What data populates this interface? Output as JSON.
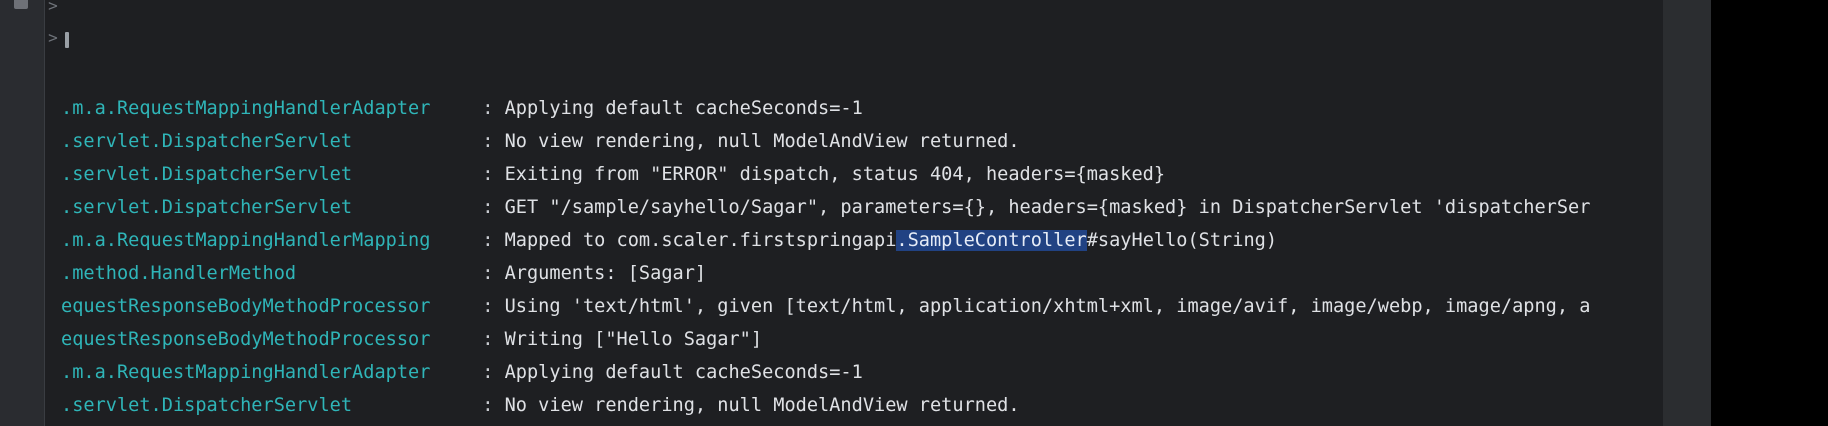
{
  "console": {
    "prompts": [
      ">",
      ">"
    ],
    "rows": [
      {
        "logger": ".m.a.RequestMappingHandlerAdapter",
        "message": "Applying default cacheSeconds=-1"
      },
      {
        "logger": ".servlet.DispatcherServlet",
        "message": "No view rendering, null ModelAndView returned."
      },
      {
        "logger": ".servlet.DispatcherServlet",
        "message": "Exiting from \"ERROR\" dispatch, status 404, headers={masked}"
      },
      {
        "logger": ".servlet.DispatcherServlet",
        "message": "GET \"/sample/sayhello/Sagar\", parameters={}, headers={masked} in DispatcherServlet 'dispatcherSer"
      },
      {
        "logger": ".m.a.RequestMappingHandlerMapping",
        "message_pre": "Mapped to com.scaler.firstspringapi",
        "message_highlight": ".SampleController",
        "message_post": "#sayHello(String)"
      },
      {
        "logger": ".method.HandlerMethod",
        "message": "Arguments: [Sagar]"
      },
      {
        "logger": "equestResponseBodyMethodProcessor",
        "message": "Using 'text/html', given [text/html, application/xhtml+xml, image/avif, image/webp, image/apng, a"
      },
      {
        "logger": "equestResponseBodyMethodProcessor",
        "message": "Writing [\"Hello Sagar\"]"
      },
      {
        "logger": ".m.a.RequestMappingHandlerAdapter",
        "message": "Applying default cacheSeconds=-1"
      },
      {
        "logger": ".servlet.DispatcherServlet",
        "message": "No view rendering, null ModelAndView returned."
      }
    ]
  },
  "colors": {
    "logger": "#2fb5b8",
    "message": "#dfe1e5",
    "selection": "#214283",
    "console_bg": "#1e1f22"
  }
}
